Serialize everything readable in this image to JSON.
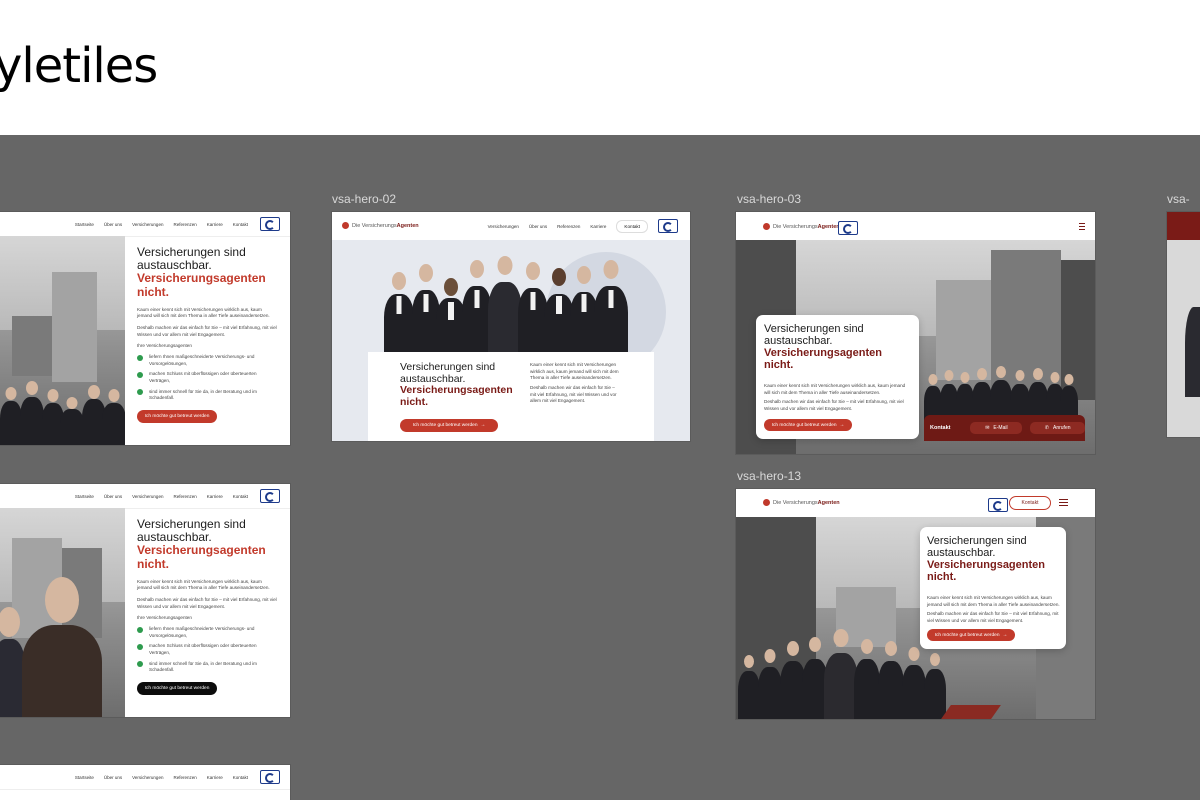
{
  "page": {
    "heading": "yletiles"
  },
  "frames": {
    "f2": {
      "label": "vsa-hero-02"
    },
    "f3": {
      "label": "vsa-hero-03"
    },
    "f13": {
      "label": "vsa-hero-13"
    },
    "f5": {
      "label": "vsa-"
    }
  },
  "nav": {
    "items": [
      "Startseite",
      "Über uns",
      "Versicherungen",
      "Referenzen",
      "Karriere",
      "Kontakt"
    ],
    "items_alt": [
      "Versicherungen",
      "Über uns",
      "Referenzen",
      "Karriere"
    ],
    "kontakt_button": "Kontakt"
  },
  "logo": {
    "prefix": "Die Versicherungs",
    "suffix": "Agenten"
  },
  "hero": {
    "title_line1": "Versicherungen sind",
    "title_line2": "austauschbar.",
    "accent_line1": "Versicherungsagenten",
    "accent_line2": "nicht.",
    "body1": "Kaum einer kennt sich mit Versicherungen wirklich aus, kaum jemand will sich mit dem Thema in aller Tiefe auseinandersetzen.",
    "body2": "Deshalb machen wir das einfach für Sie – mit viel Erfahnung, mit viel Wissen und vor allem mit viel Engagement.",
    "list_heading": "Ihre Versicherungsagenten",
    "bullets": [
      "liefern Ihnen maßgeschneiderte Versicherungs- und Vorsorgelösungen,",
      "machen Schluss mit überflüssigen oder überteuerten Verträgen,",
      "sind immer schnell für Sie da, in der Beratung und im Schadenfall."
    ],
    "cta": "Ich möchte gut betreut werden"
  },
  "contact_bar": {
    "label": "Kontakt",
    "email": "E-Mail",
    "call": "Anrufen"
  },
  "colors": {
    "accent": "#c23a2b",
    "accent_dark": "#7a1b17",
    "canvas": "#666666",
    "check": "#2e9b4e"
  }
}
